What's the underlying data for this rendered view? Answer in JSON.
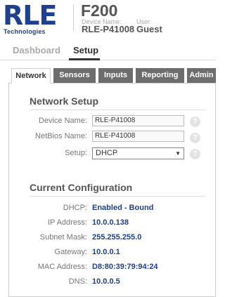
{
  "header": {
    "logo_text": "RLE",
    "logo_subtext": "Technologies",
    "model": "F200",
    "device_name_label": "Device Name:",
    "device_name_value": "RLE-P41008",
    "user_label": "User:",
    "user_value": "Guest"
  },
  "nav": {
    "dashboard": "Dashboard",
    "setup": "Setup"
  },
  "tabs": [
    "Network",
    "Sensors",
    "Inputs",
    "Reporting",
    "Admin"
  ],
  "network_setup": {
    "title": "Network Setup",
    "device_name_label": "Device Name:",
    "device_name_value": "RLE-P41008",
    "netbios_label": "NetBios Name:",
    "netbios_value": "RLE-P41008",
    "setup_label": "Setup:",
    "setup_value": "DHCP",
    "help_icon": "?"
  },
  "current_config": {
    "title": "Current Configuration",
    "rows": [
      {
        "label": "DHCP:",
        "value": "Enabled - Bound"
      },
      {
        "label": "IP Address:",
        "value": "10.0.0.138"
      },
      {
        "label": "Subnet Mask:",
        "value": "255.255.255.0"
      },
      {
        "label": "Gateway:",
        "value": "10.0.0.1"
      },
      {
        "label": "MAC Address:",
        "value": "D8:80:39:79:94:24"
      },
      {
        "label": "DNS:",
        "value": "10.0.0.5"
      }
    ]
  },
  "colors": {
    "brand_blue": "#1f3f8f",
    "tab_inactive": "#6d6d6d"
  }
}
